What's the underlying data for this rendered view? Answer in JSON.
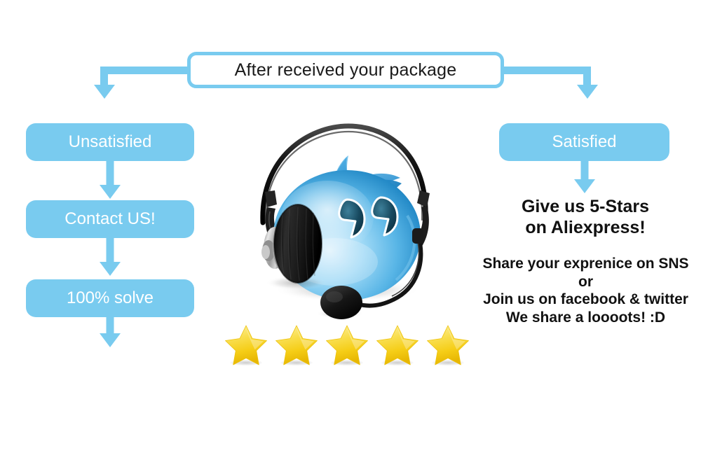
{
  "page": {
    "background_color": "#ffffff",
    "accent_color": "#79cbef",
    "text_color": "#111111",
    "star_color": "#f7d417"
  },
  "title": {
    "label": "After received your package"
  },
  "left_branch": {
    "boxes": [
      {
        "label": "Unsatisfied"
      },
      {
        "label": "Contact US!"
      },
      {
        "label": "100% solve"
      }
    ]
  },
  "right_branch": {
    "box": {
      "label": "Satisfied"
    },
    "heading_lines": [
      "Give us 5-Stars",
      "on Aliexpress!"
    ],
    "body_lines": [
      "Share your exprenice on SNS",
      "or",
      "Join us on facebook & twitter",
      "We share a loooots! :D"
    ]
  },
  "rating": {
    "star_count": 5,
    "stars": [
      {
        "filled": true
      },
      {
        "filled": true
      },
      {
        "filled": true
      },
      {
        "filled": true
      },
      {
        "filled": true
      }
    ]
  },
  "mascot": {
    "name": "customer-support-droplet-mascot",
    "body_color": "#3ea7e0",
    "highlight_color": "#bfe6fa",
    "headset_color": "#1c1c1c"
  }
}
